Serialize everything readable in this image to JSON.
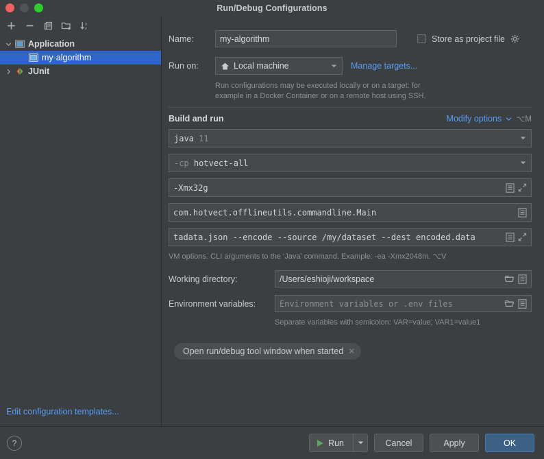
{
  "window": {
    "title": "Run/Debug Configurations",
    "traffic_lights": [
      "close-red",
      "minimize-grey",
      "zoom-green"
    ]
  },
  "sidebar": {
    "toolbar": [
      {
        "name": "add-configuration",
        "glyph": "+"
      },
      {
        "name": "remove-configuration",
        "glyph": "−"
      },
      {
        "name": "copy-configuration",
        "glyph": "copy"
      },
      {
        "name": "new-folder",
        "glyph": "folder-add"
      },
      {
        "name": "sort-alphabetically",
        "glyph": "sort-az"
      }
    ],
    "tree": [
      {
        "label": "Application",
        "type": "group",
        "expanded": true,
        "selected": false,
        "icon": "application-icon"
      },
      {
        "label": "my-algorithm",
        "type": "item",
        "selected": true,
        "icon": "application-icon"
      },
      {
        "label": "JUnit",
        "type": "group",
        "expanded": false,
        "selected": false,
        "icon": "junit-icon"
      }
    ],
    "edit_templates_link": "Edit configuration templates..."
  },
  "main": {
    "name_label": "Name:",
    "name_value": "my-algorithm",
    "store_as_project_file": {
      "label": "Store as project file",
      "checked": false,
      "gear_icon": "gear-icon"
    },
    "run_on_label": "Run on:",
    "run_on_value": "Local machine",
    "run_on_icon": "home-icon",
    "manage_targets_link": "Manage targets...",
    "run_on_hint_line1": "Run configurations may be executed locally or on a target: for",
    "run_on_hint_line2": "example in a Docker Container or on a remote host using SSH.",
    "build_and_run_title": "Build and run",
    "modify_options_link": "Modify options",
    "modify_options_shortcut": "⌥M",
    "jdk_cmd": "java",
    "jdk_version": "11",
    "module_flag": "-cp",
    "module_name": "hotvect-all",
    "vm_options_value": "-Xmx32g",
    "main_class_value": "com.hotvect.offlineutils.commandline.Main",
    "program_args_value": "tadata.json --encode --source /my/dataset --dest encoded.data",
    "vm_options_hint": "VM options. CLI arguments to the ‘Java’ command. Example: -ea -Xmx2048m. ⌥V",
    "working_dir_label": "Working directory:",
    "working_dir_value": "/Users/eshioji/workspace",
    "env_vars_label": "Environment variables:",
    "env_vars_placeholder": "Environment variables or .env files",
    "env_vars_hint": "Separate variables with semicolon: VAR=value; VAR1=value1",
    "tool_window_chip": "Open run/debug tool window when started",
    "chip_close_icon": "close-icon",
    "icons": {
      "expand_editor": "expand-icon",
      "macro_list": "list-icon",
      "browse_folder": "folder-icon"
    }
  },
  "footer": {
    "help_label": "?",
    "run_label": "Run",
    "cancel_label": "Cancel",
    "apply_label": "Apply",
    "ok_label": "OK"
  },
  "colors": {
    "accent_blue": "#2f65ca",
    "link_blue": "#589df6",
    "ok_button": "#3d6185",
    "run_green": "#5fa55f",
    "background": "#3c3f41",
    "field_background": "#45494a"
  }
}
